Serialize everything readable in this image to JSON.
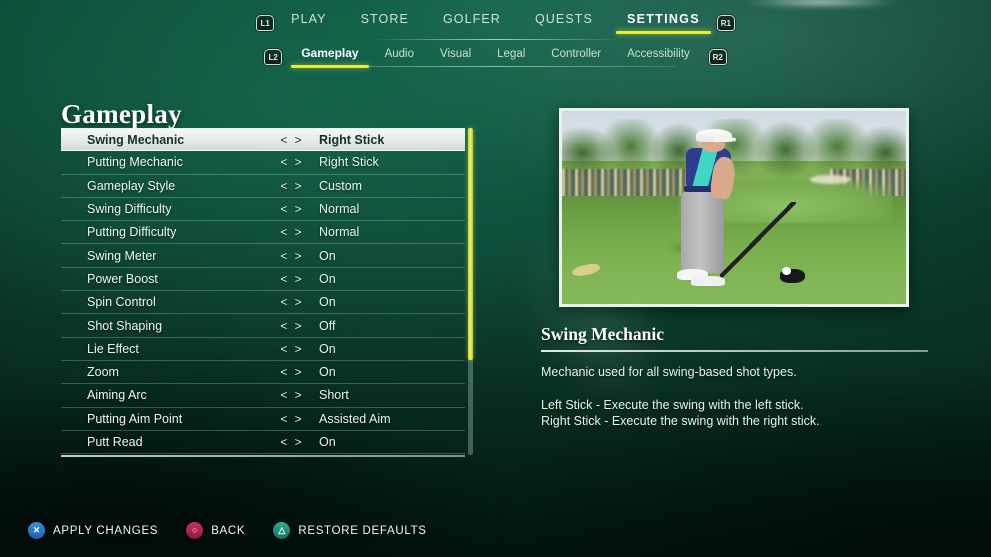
{
  "topnav": {
    "left_bumper": "L1",
    "right_bumper": "R1",
    "items": [
      {
        "label": "PLAY",
        "active": false
      },
      {
        "label": "STORE",
        "active": false
      },
      {
        "label": "GOLFER",
        "active": false
      },
      {
        "label": "QUESTS",
        "active": false
      },
      {
        "label": "SETTINGS",
        "active": true
      }
    ]
  },
  "subnav": {
    "left_trigger": "L2",
    "right_trigger": "R2",
    "items": [
      {
        "label": "Gameplay",
        "active": true
      },
      {
        "label": "Audio",
        "active": false
      },
      {
        "label": "Visual",
        "active": false
      },
      {
        "label": "Legal",
        "active": false
      },
      {
        "label": "Controller",
        "active": false
      },
      {
        "label": "Accessibility",
        "active": false
      }
    ]
  },
  "page": {
    "title": "Gameplay"
  },
  "settings": {
    "arrows": "< >",
    "rows": [
      {
        "label": "Swing Mechanic",
        "value": "Right Stick",
        "selected": true
      },
      {
        "label": "Putting Mechanic",
        "value": "Right Stick",
        "selected": false
      },
      {
        "label": "Gameplay Style",
        "value": "Custom",
        "selected": false
      },
      {
        "label": "Swing Difficulty",
        "value": "Normal",
        "selected": false
      },
      {
        "label": "Putting Difficulty",
        "value": "Normal",
        "selected": false
      },
      {
        "label": "Swing Meter",
        "value": "On",
        "selected": false
      },
      {
        "label": "Power Boost",
        "value": "On",
        "selected": false
      },
      {
        "label": "Spin Control",
        "value": "On",
        "selected": false
      },
      {
        "label": "Shot Shaping",
        "value": "Off",
        "selected": false
      },
      {
        "label": "Lie Effect",
        "value": "On",
        "selected": false
      },
      {
        "label": "Zoom",
        "value": "On",
        "selected": false
      },
      {
        "label": "Aiming Arc",
        "value": "Short",
        "selected": false
      },
      {
        "label": "Putting Aim Point",
        "value": "Assisted Aim",
        "selected": false
      },
      {
        "label": "Putt Read",
        "value": "On",
        "selected": false
      }
    ]
  },
  "detail": {
    "title": "Swing Mechanic",
    "paragraph1": "Mechanic used for all swing-based shot types.",
    "line_left": "Left Stick - Execute the swing with the left stick.",
    "line_right": "Right Stick - Execute the swing with the right stick."
  },
  "preview": {
    "alt": "golfer-addressing-ball-with-driver"
  },
  "bottom": {
    "prompts": [
      {
        "glyph": "✕",
        "label": "APPLY CHANGES",
        "icon": "cross-button-icon"
      },
      {
        "glyph": "○",
        "label": "BACK",
        "icon": "circle-button-icon"
      },
      {
        "glyph": "△",
        "label": "RESTORE DEFAULTS",
        "icon": "triangle-button-icon"
      }
    ]
  },
  "colors": {
    "accent_yellow": "#e4ef36",
    "background_green": "#0d4a39",
    "selected_row_bg": "#e6ebe7"
  }
}
